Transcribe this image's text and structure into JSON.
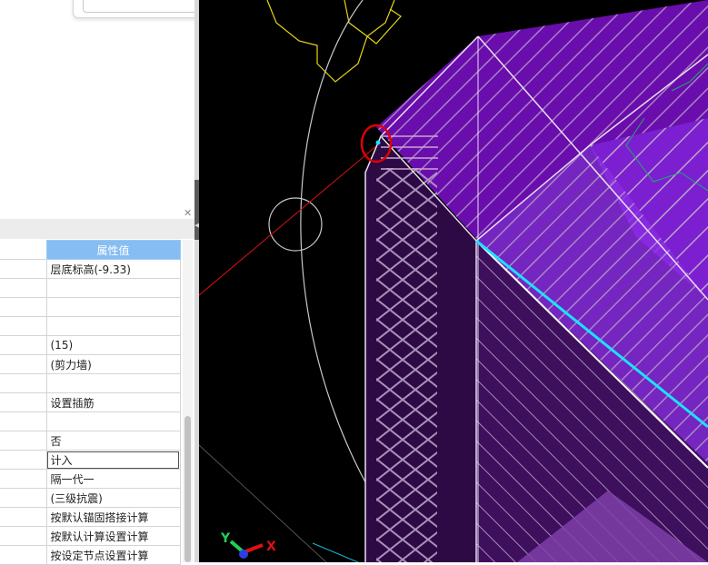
{
  "property_panel": {
    "header": {
      "value_column": "属性值"
    },
    "rows": [
      {
        "value": "层底标高(-9.33)"
      },
      {
        "value": ""
      },
      {
        "value": ""
      },
      {
        "value": ""
      },
      {
        "value": "(15)"
      },
      {
        "value": "(剪力墙)"
      },
      {
        "value": ""
      },
      {
        "value": "设置插筋"
      },
      {
        "value": ""
      },
      {
        "value": "否"
      },
      {
        "value": "计入"
      },
      {
        "value": "隔一代一"
      },
      {
        "value": "(三级抗震)"
      },
      {
        "value": "按默认锚固搭接计算"
      },
      {
        "value": "按默认计算设置计算"
      },
      {
        "value": "按设定节点设置计算"
      }
    ],
    "close_icon": "close-icon"
  },
  "viewport": {
    "background": "#000000",
    "axis_triad": {
      "y_label": "Y",
      "x_label": "X"
    },
    "colors": {
      "wall_purple": "#6a0dad",
      "wall_light": "#8a2be2",
      "hatch": "#b89fc8",
      "cyan_edge": "#19e3ff",
      "red_line": "#e01010",
      "yellow_line": "#e6d414",
      "green_line": "#1fa86f",
      "highlight_circle": "#e00000"
    }
  }
}
